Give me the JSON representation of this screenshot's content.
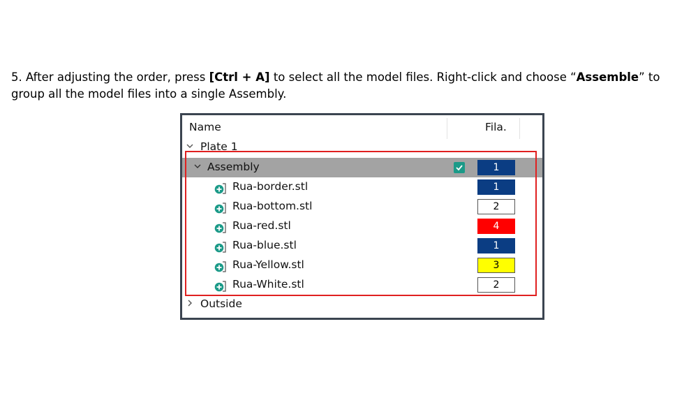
{
  "instruction": {
    "p1": "5. After adjusting the order, press ",
    "key_combo": "[Ctrl + A]",
    "p2": " to select all the model files. Right-click and choose “",
    "assemble_word": "Assemble",
    "p3": "” to group all the model files into a single Assembly."
  },
  "columns": {
    "name": "Name",
    "fila": "Fila."
  },
  "tree": {
    "plate_label": "Plate 1",
    "assembly": {
      "label": "Assembly",
      "checked": true,
      "filament": "1",
      "filament_color": "#0b3d83",
      "text_color": "#ffffff"
    },
    "files": [
      {
        "label": "Rua-border.stl",
        "filament": "1",
        "filament_color": "#0b3d83",
        "text_color": "#ffffff"
      },
      {
        "label": "Rua-bottom.stl",
        "filament": "2",
        "filament_color": "#ffffff",
        "text_color": "#000000"
      },
      {
        "label": "Rua-red.stl",
        "filament": "4",
        "filament_color": "#ff0000",
        "text_color": "#ffffff"
      },
      {
        "label": "Rua-blue.stl",
        "filament": "1",
        "filament_color": "#0b3d83",
        "text_color": "#ffffff"
      },
      {
        "label": "Rua-Yellow.stl",
        "filament": "3",
        "filament_color": "#ffff00",
        "text_color": "#000000"
      },
      {
        "label": "Rua-White.stl",
        "filament": "2",
        "filament_color": "#ffffff",
        "text_color": "#000000"
      }
    ],
    "outside_label": "Outside"
  },
  "icons": {
    "chevron_expanded": "chevron-down-icon",
    "chevron_collapsed": "chevron-right-icon",
    "add_part": "add-part-icon",
    "checkbox": "checkbox-icon"
  },
  "colors": {
    "highlight_box": "#e02020",
    "selection": "#a3a3a3",
    "checkbox": "#1b9a88",
    "panel_border": "#3b4450"
  }
}
